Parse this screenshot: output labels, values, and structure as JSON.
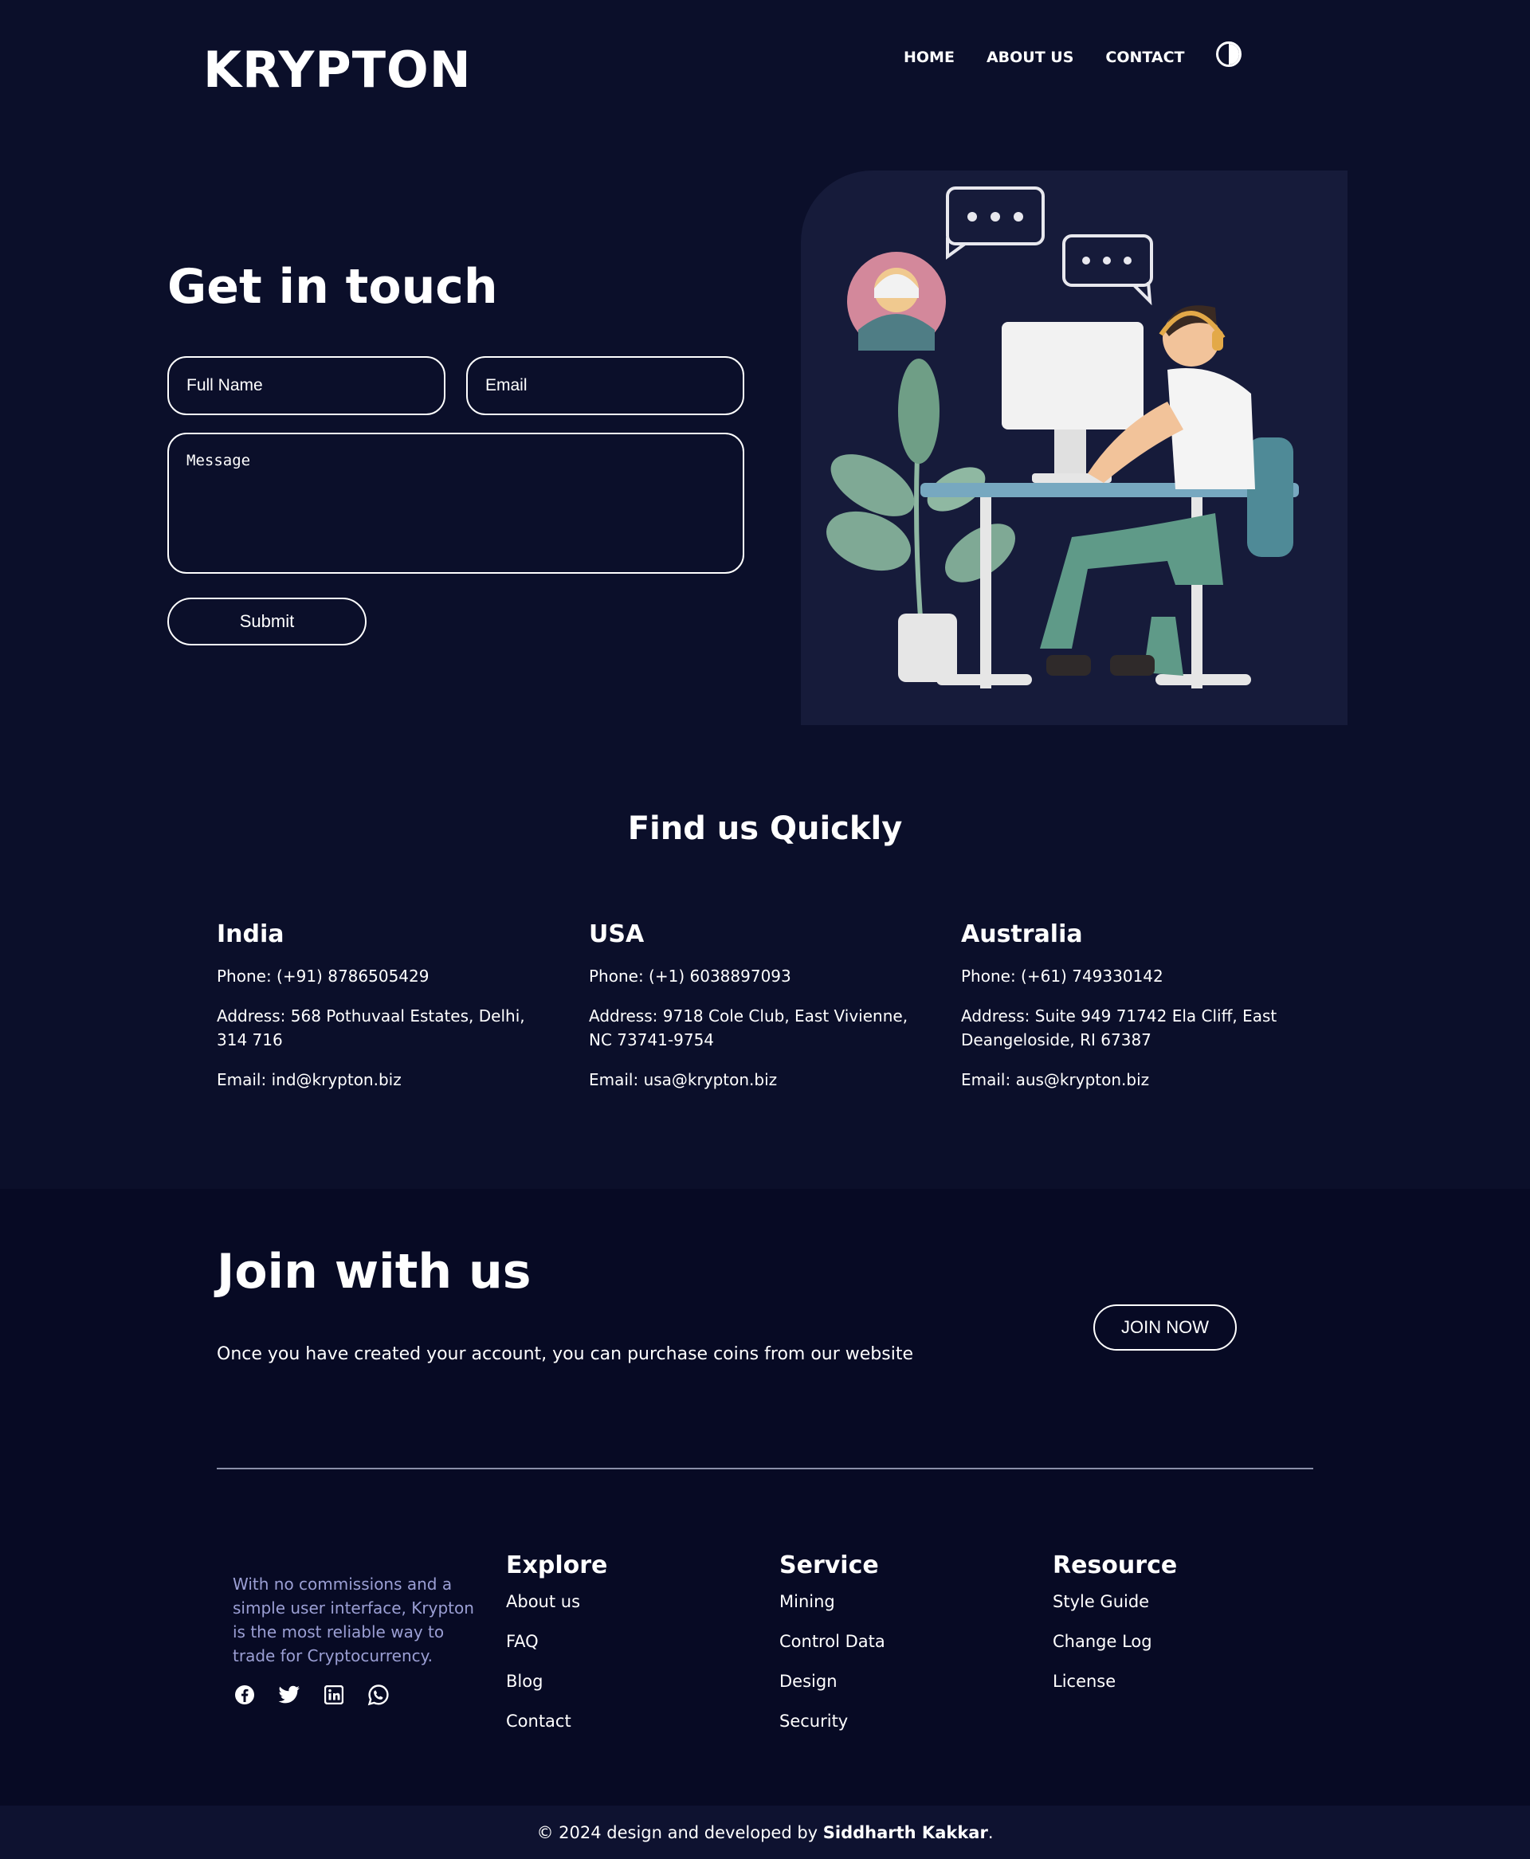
{
  "brand": {
    "logo": "KRYPTON"
  },
  "nav": {
    "items": [
      "HOME",
      "ABOUT US",
      "CONTACT"
    ]
  },
  "contact": {
    "title": "Get in touch",
    "name_placeholder": "Full Name",
    "email_placeholder": "Email",
    "message_placeholder": "Message",
    "submit_label": "Submit"
  },
  "find": {
    "title": "Find us Quickly",
    "offices": [
      {
        "country": "India",
        "phone": "Phone: (+91) 8786505429",
        "address": "Address: 568 Pothuvaal Estates, Delhi, 314 716",
        "email": "Email: ind@krypton.biz"
      },
      {
        "country": "USA",
        "phone": "Phone: (+1) 6038897093",
        "address": "Address: 9718 Cole Club, East Vivienne, NC 73741-9754",
        "email": "Email: usa@krypton.biz"
      },
      {
        "country": "Australia",
        "phone": "Phone: (+61) 749330142",
        "address": "Address: Suite 949 71742 Ela Cliff, East Deangeloside, RI 67387",
        "email": "Email: aus@krypton.biz"
      }
    ]
  },
  "join": {
    "title": "Join with us",
    "text": "Once you have created your account, you can purchase coins from our website",
    "button": "JOIN NOW"
  },
  "footer": {
    "about": "With no commissions and a simple user interface, Krypton is the most reliable way to trade for Cryptocurrency.",
    "socials": [
      "facebook-icon",
      "twitter-icon",
      "linkedin-icon",
      "whatsapp-icon"
    ],
    "columns": [
      {
        "title": "Explore",
        "links": [
          "About us",
          "FAQ",
          "Blog",
          "Contact"
        ]
      },
      {
        "title": "Service",
        "links": [
          "Mining",
          "Control Data",
          "Design",
          "Security"
        ]
      },
      {
        "title": "Resource",
        "links": [
          "Style Guide",
          "Change Log",
          "License"
        ]
      }
    ],
    "copyright_prefix": "© 2024 design and developed by ",
    "author": "Siddharth Kakkar",
    "copyright_suffix": "."
  },
  "colors": {
    "background": "#0b0f2a",
    "band": "#070a24",
    "muted_text": "#9b9fd4",
    "card": "#161b3a"
  }
}
